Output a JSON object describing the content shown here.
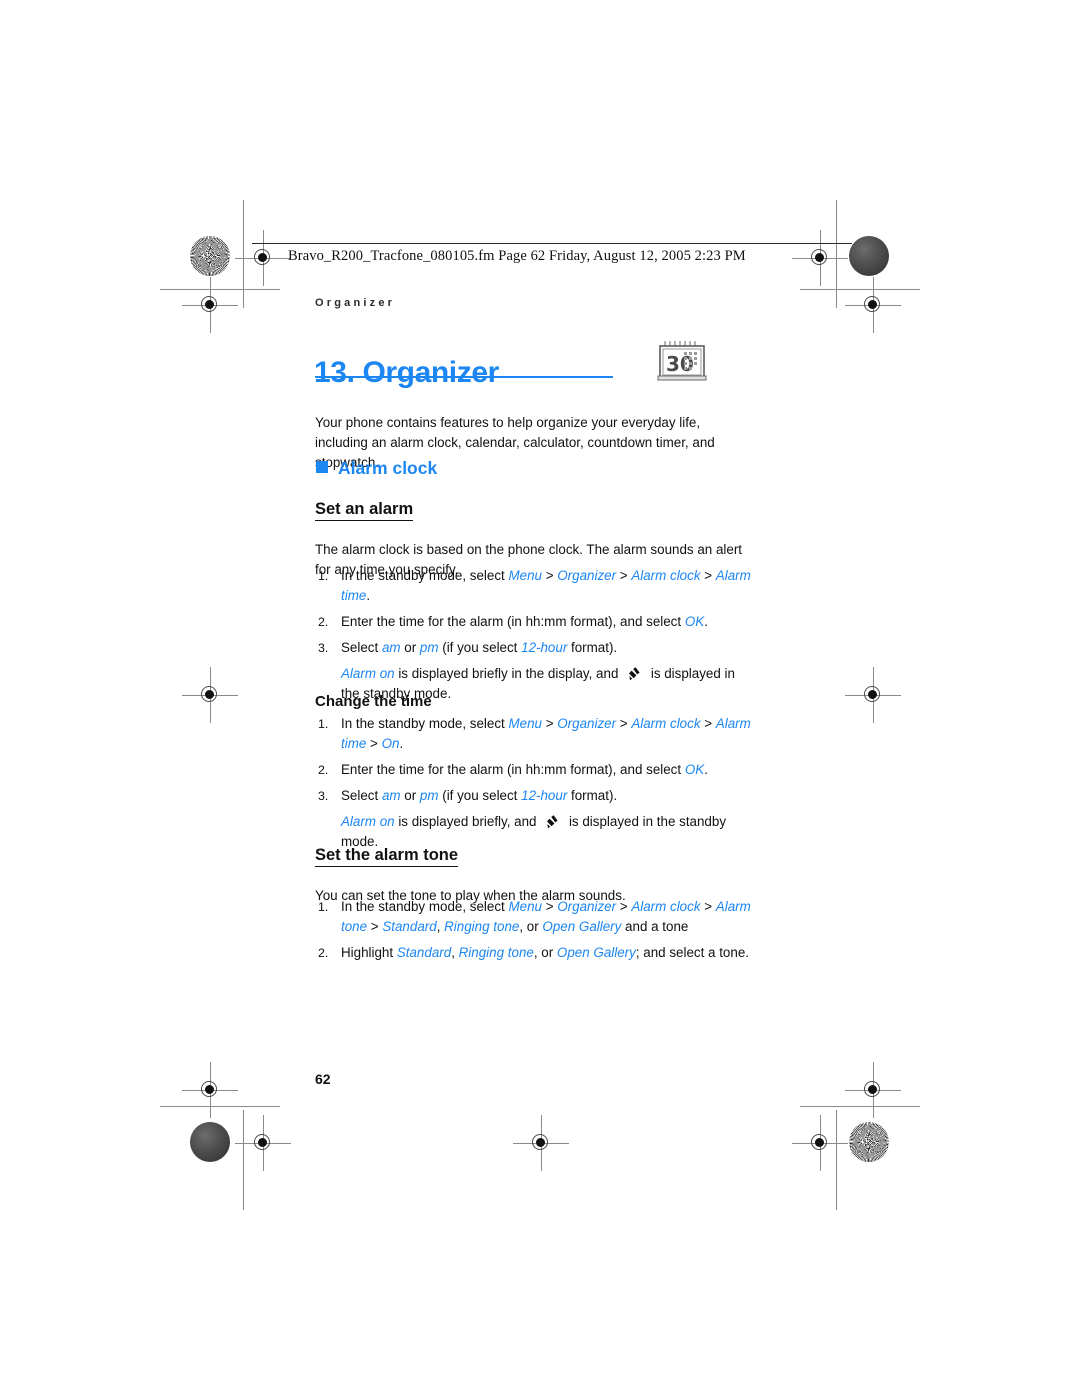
{
  "print_header": {
    "file_line": "Bravo_R200_Tracfone_080105.fm  Page 62  Friday, August 12, 2005  2:23 PM"
  },
  "running_head": "Organizer",
  "chapter": {
    "title": "13. Organizer",
    "icon": "calendar-icon",
    "icon_day": "30",
    "accent_color": "#1c86f2",
    "intro": "Your phone contains features to help organize your everyday life, including an alarm clock, calendar, calculator, countdown timer, and stopwatch."
  },
  "sections": {
    "alarm_clock_heading": "Alarm clock",
    "set_an_alarm": {
      "heading": "Set an alarm",
      "intro": "The alarm clock is based on the phone clock. The alarm sounds an alert for any time you specify.",
      "steps": [
        {
          "num": "1.",
          "lead": "In the standby mode, select ",
          "path": [
            "Menu",
            "Organizer",
            "Alarm clock",
            "Alarm time"
          ],
          "tail": "."
        },
        {
          "num": "2.",
          "lead": "Enter the time for the alarm (in hh:mm format), and select ",
          "ui": "OK",
          "tail": "."
        },
        {
          "num": "3.",
          "lead": "Select ",
          "ui1": "am",
          "mid1": " or ",
          "ui2": "pm",
          "mid2": " (if you select ",
          "ui3": "12-hour",
          "tail": " format)."
        }
      ],
      "note": {
        "ui": "Alarm on",
        "part1": " is displayed briefly in the display, and ",
        "icon": "alarm-bell-icon",
        "part2": " is displayed in the standby mode."
      }
    },
    "change_the_time": {
      "heading": "Change the time",
      "steps": [
        {
          "num": "1.",
          "lead": "In the standby mode, select ",
          "path": [
            "Menu",
            "Organizer",
            "Alarm clock",
            "Alarm time",
            "On"
          ],
          "tail": "."
        },
        {
          "num": "2.",
          "lead": "Enter the time for the alarm (in hh:mm format), and select ",
          "ui": "OK",
          "tail": "."
        },
        {
          "num": "3.",
          "lead": "Select ",
          "ui1": "am",
          "mid1": " or ",
          "ui2": "pm",
          "mid2": " (if you select ",
          "ui3": "12-hour",
          "tail": " format)."
        }
      ],
      "note": {
        "ui": "Alarm on",
        "part1": " is displayed briefly, and ",
        "icon": "alarm-bell-icon",
        "part2": " is displayed in the standby mode."
      }
    },
    "set_the_alarm_tone": {
      "heading": "Set the alarm tone",
      "intro": "You can set the tone to play when the alarm sounds.",
      "steps": [
        {
          "num": "1.",
          "lead": "In the standby mode, select ",
          "path": [
            "Menu",
            "Organizer",
            "Alarm clock",
            "Alarm tone"
          ],
          "opts": [
            "Standard",
            "Ringing tone",
            "Open Gallery"
          ],
          "tail": " and a tone"
        },
        {
          "num": "2.",
          "lead": "Highlight ",
          "opts": [
            "Standard",
            "Ringing tone",
            "Open Gallery"
          ],
          "tail": "; and select a tone."
        }
      ]
    }
  },
  "page_number": "62"
}
